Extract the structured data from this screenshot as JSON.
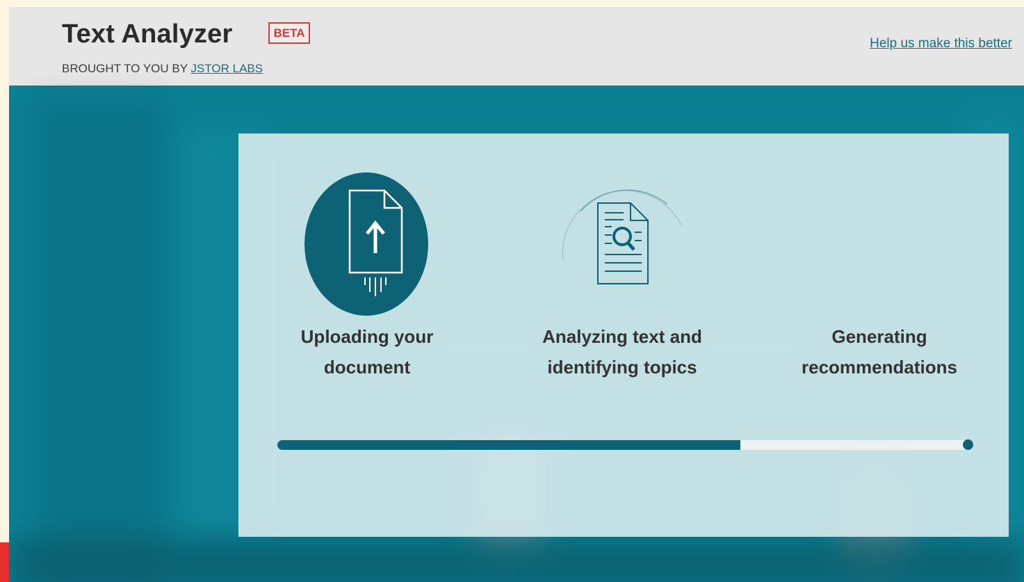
{
  "header": {
    "title": "Text Analyzer",
    "badge": "BETA",
    "byline_prefix": "BROUGHT TO YOU BY",
    "byline_link": "JSTOR LABS",
    "help_link": "Help us make this better"
  },
  "steps": [
    {
      "line1": "Uploading your",
      "line2": "document",
      "icon": "upload-document-icon",
      "state": "done"
    },
    {
      "line1": "Analyzing text and",
      "line2": "identifying topics",
      "icon": "analyze-document-icon",
      "state": "active"
    },
    {
      "line1": "Generating",
      "line2": "recommendations",
      "icon": "none",
      "state": "pending"
    }
  ],
  "progress": {
    "fraction": 0.67
  },
  "colors": {
    "accent": "#0d6275",
    "badge": "#d33a3a",
    "link": "#1b6e80",
    "hero": "#0c7f93"
  }
}
